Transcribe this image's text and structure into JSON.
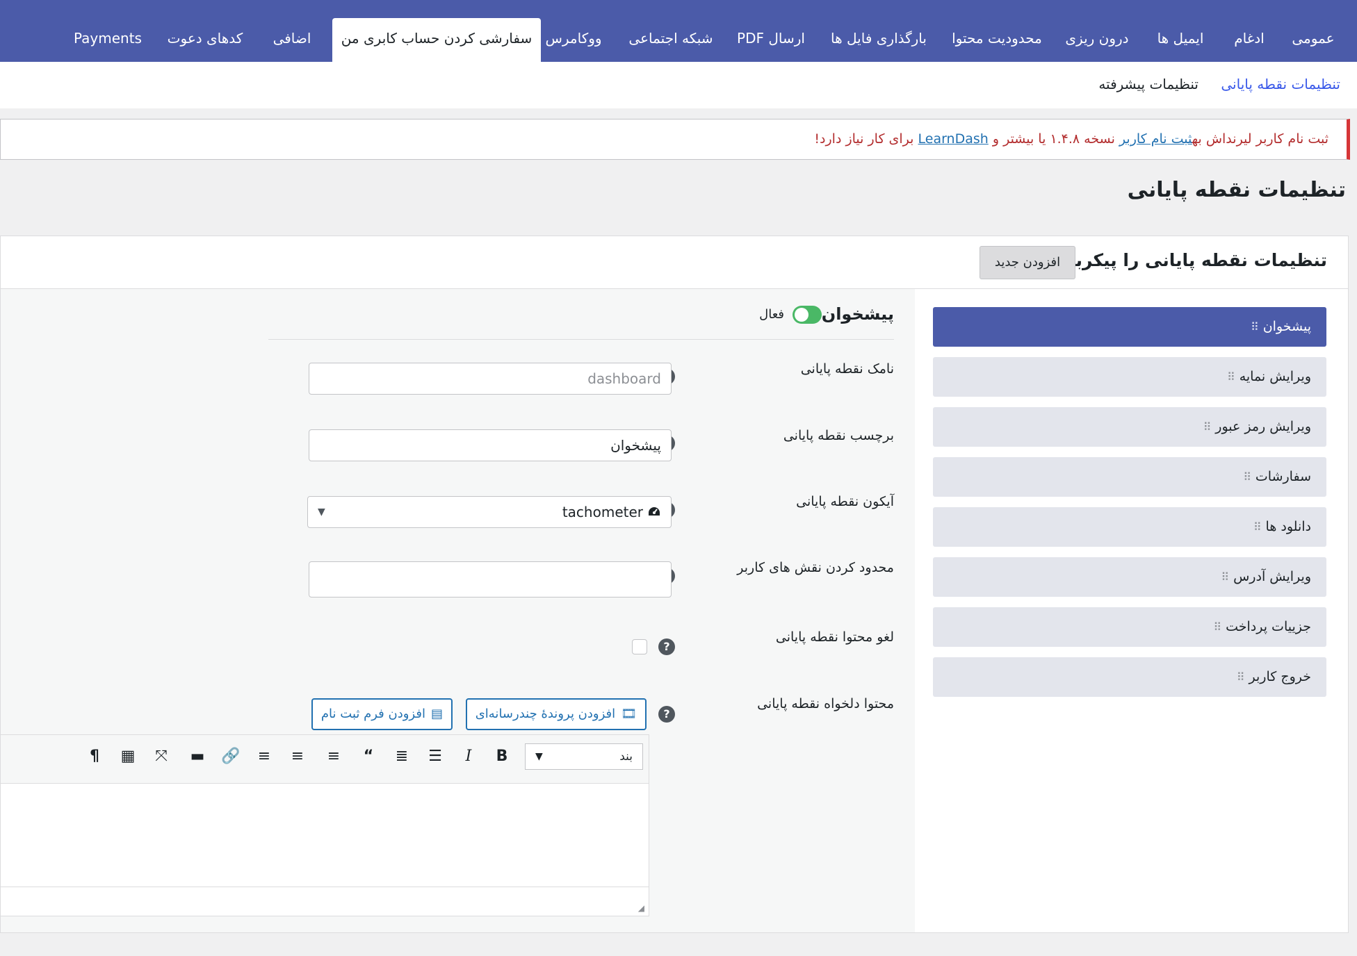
{
  "top_tabs": [
    {
      "label": "عمومی"
    },
    {
      "label": "ادغام"
    },
    {
      "label": "ایمیل ها"
    },
    {
      "label": "درون ریزی"
    },
    {
      "label": "محدودیت محتوا"
    },
    {
      "label": "بارگذاری فایل ها"
    },
    {
      "label": "ارسال PDF"
    },
    {
      "label": "شبکه اجتماعی"
    },
    {
      "label": "ووکامرس"
    },
    {
      "label": "سفارشی کردن حساب کابری من"
    },
    {
      "label": "اضافی"
    },
    {
      "label": "کدهای دعوت"
    },
    {
      "label": "Payments"
    }
  ],
  "sub_tabs": [
    {
      "label": "تنظیمات نقطه پایانی"
    },
    {
      "label": "تنظیمات پیشرفته"
    }
  ],
  "notice": {
    "prefix": "ثبت نام کاربر لیرنداش به",
    "link1": "ثبت نام کاربر",
    "middle": " نسخه ۱.۴.۸ یا بیشتر و ",
    "link2": "LearnDash",
    "suffix": " برای کار نیاز دارد!"
  },
  "page_title": "تنظیمات نقطه پایانی",
  "box": {
    "title": "تنظیمات نقطه پایانی را پیکربندی کنید",
    "add_new": "افزودن جدید"
  },
  "endpoints": [
    {
      "label": "پیشخوان"
    },
    {
      "label": "ویرایش نمایه"
    },
    {
      "label": "ویرایش رمز عبور"
    },
    {
      "label": "سفارشات"
    },
    {
      "label": "دانلود ها"
    },
    {
      "label": "ویرایش آدرس"
    },
    {
      "label": "جزییات پرداخت"
    },
    {
      "label": "خروج کاربر"
    }
  ],
  "panel": {
    "title": "پیشخوان",
    "toggle_label": "فعال",
    "fields": {
      "slug_label": "نامک نقطه پایانی",
      "slug_placeholder": "dashboard",
      "label_label": "برچسب نقطه پایانی",
      "label_value": "پیشخوان",
      "icon_label": "آیکون نقطه پایانی",
      "icon_value": "tachometer",
      "roles_label": "محدود کردن نقش های کاربر",
      "disable_label": "لغو محتوا نقطه پایانی",
      "content_label": "محتوا دلخواه نقطه پایانی"
    },
    "buttons": {
      "add_media": "افزودن پروندهٔ چندرسانه‌ای",
      "add_form": "افزودن فرم ثبت نام"
    },
    "editor": {
      "format": "بند"
    }
  },
  "icons": {
    "help": "?",
    "grip": "⠿"
  },
  "colors": {
    "primary": "#4b5ba9",
    "link": "#2271b1",
    "notice_border": "#d63638",
    "toggle_on": "#4ab866"
  }
}
